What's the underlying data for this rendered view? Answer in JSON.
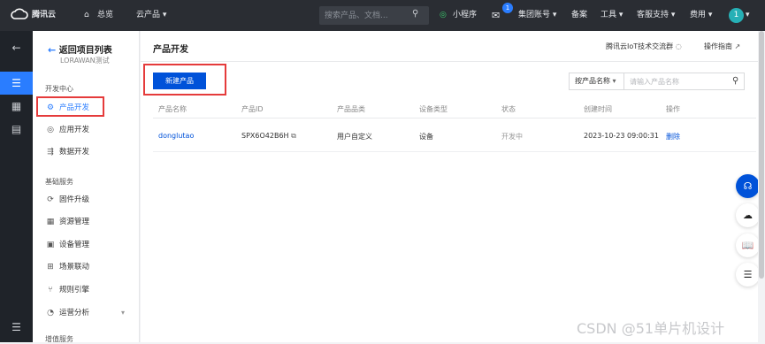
{
  "topbar": {
    "brand": "腾讯云",
    "home": "总览",
    "cloud_products": "云产品",
    "search_placeholder": "搜索产品、文档...",
    "mini_program": "小程序",
    "message_count": "1",
    "group_account": "集团账号",
    "filing": "备案",
    "tools": "工具",
    "support": "客服支持",
    "billing": "费用",
    "avatar_text": "1"
  },
  "sidebar": {
    "back_label": "返回项目列表",
    "project_name": "LORAWAN测试",
    "dev_center": "开发中心",
    "product_dev": "产品开发",
    "app_dev": "应用开发",
    "data_dev": "数据开发",
    "basic_services": "基础服务",
    "firmware": "固件升级",
    "resources": "资源管理",
    "devices": "设备管理",
    "scene": "场景联动",
    "rule_engine": "规则引擎",
    "ops_analysis": "运营分析",
    "value_services": "增值服务"
  },
  "header": {
    "title": "产品开发",
    "iot_group": "腾讯云IoT技术交流群",
    "guide": "操作指南"
  },
  "toolbar": {
    "new_product": "新建产品",
    "filter_select": "按产品名称",
    "filter_placeholder": "请输入产品名称"
  },
  "table": {
    "columns": [
      "产品名称",
      "产品ID",
      "产品品类",
      "设备类型",
      "状态",
      "创建时间",
      "操作"
    ],
    "rows": [
      {
        "name": "donglutao",
        "id": "SPX6O42B6H",
        "category": "用户自定义",
        "device_type": "设备",
        "status": "开发中",
        "created": "2023-10-23 09:00:31",
        "action": "删除"
      }
    ]
  },
  "watermark": "CSDN @51单片机设计",
  "colors": {
    "accent": "#0052d9",
    "highlight_box": "#e53b3b",
    "topbar_bg": "#2a2d33"
  }
}
